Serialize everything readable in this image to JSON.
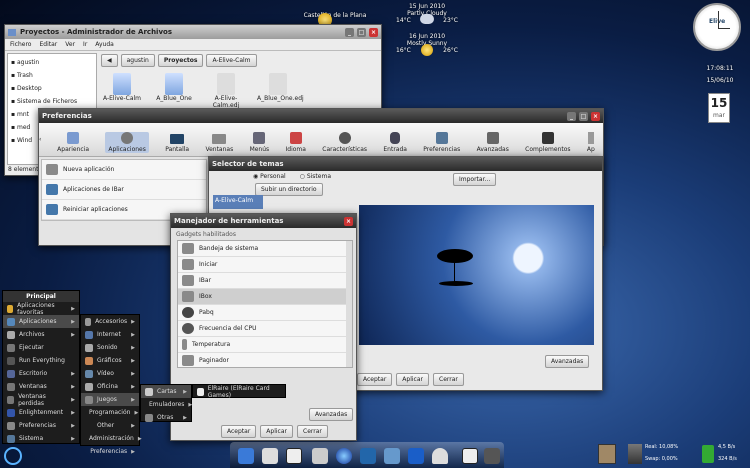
{
  "weather": {
    "city": "Castellón de la Plana",
    "day1": {
      "date": "15 Jun 2010",
      "condition": "Partly Cloudy",
      "low": "14°C",
      "high": "23°C"
    },
    "day2": {
      "date": "16 Jun 2010",
      "condition": "Mostly Sunny",
      "low": "16°C",
      "high": "26°C"
    }
  },
  "clock": {
    "brand": "Elive",
    "sub": "Dul",
    "time": "17:08:11",
    "date": "15/06/10"
  },
  "calendar": {
    "day": "15",
    "weekday": "mar"
  },
  "file_manager": {
    "title": "Proyectos - Administrador de Archivos",
    "menu": [
      "Fichero",
      "Editar",
      "Ver",
      "Ir",
      "Ayuda"
    ],
    "places": [
      "agustin",
      "Trash",
      "Desktop",
      "Sistema de Ficheros",
      "mnt",
      "med",
      "Wind"
    ],
    "path": [
      "agustin",
      "Proyectos",
      "A-Elive-Calm"
    ],
    "files": [
      "A-Elive-Calm",
      "A_Blue_One",
      "A-Elive-Calm.edj",
      "A_Blue_One.edj"
    ],
    "status": "8 element"
  },
  "prefs": {
    "title": "Preferencias",
    "toolbar": [
      "Apariencia",
      "Aplicaciones",
      "Pantalla",
      "Ventanas",
      "Menús",
      "Idioma",
      "Características",
      "Entrada",
      "Preferencias",
      "Avanzadas",
      "Complementos",
      "Ap"
    ],
    "active": "Aplicaciones",
    "side": [
      "Nueva aplicación",
      "Aplicaciones de IBar",
      "Reiniciar aplicaciones"
    ]
  },
  "theme_selector": {
    "title": "Selector de temas",
    "tabs": [
      "Personal",
      "Sistema"
    ],
    "import_label": "Importar...",
    "upload_label": "Subir un directorio",
    "theme_name": "A-Elive-Calm",
    "advanced_label": "Avanzadas",
    "buttons": [
      "Aceptar",
      "Aplicar",
      "Cerrar"
    ]
  },
  "tool_manager": {
    "title": "Manejador de herramientas",
    "section": "Gadgets habilitados",
    "items": [
      "Bandeja de sistema",
      "Iniciar",
      "IBar",
      "IBox",
      "Pabq",
      "Frecuencia del CPU",
      "Temperatura",
      "Paginador"
    ],
    "selected": "IBox",
    "advanced_label": "Avanzadas",
    "buttons": [
      "Aceptar",
      "Aplicar",
      "Cerrar"
    ]
  },
  "main_menu": {
    "title": "Principal",
    "items": [
      "Aplicaciones favoritas",
      "Aplicaciones",
      "Archivos",
      "Ejecutar",
      "Run Everything",
      "Escritorio",
      "Ventanas",
      "Ventanas perdidas",
      "Enlightenment",
      "Preferencias",
      "Sistema"
    ]
  },
  "apps_menu": [
    "Accesorios",
    "Internet",
    "Sonido",
    "Gráficos",
    "Vídeo",
    "Oficina",
    "Juegos",
    "Programación",
    "Other",
    "Administración",
    "Preferencias"
  ],
  "games_menu": [
    "Cartas",
    "Emuladores",
    "Otras"
  ],
  "cards_menu": [
    "ElRaire (ElRaire Card Games)"
  ],
  "sysmon": {
    "real": "Real: 10,08%",
    "swap": "Swap: 0,00%",
    "net1": "4,5 B/s",
    "net2": "324 B/s"
  },
  "colors": {
    "menu_bg": "#1d1d1d",
    "title_grad": "#9c9c9c",
    "desktop": "#1b3d78"
  }
}
